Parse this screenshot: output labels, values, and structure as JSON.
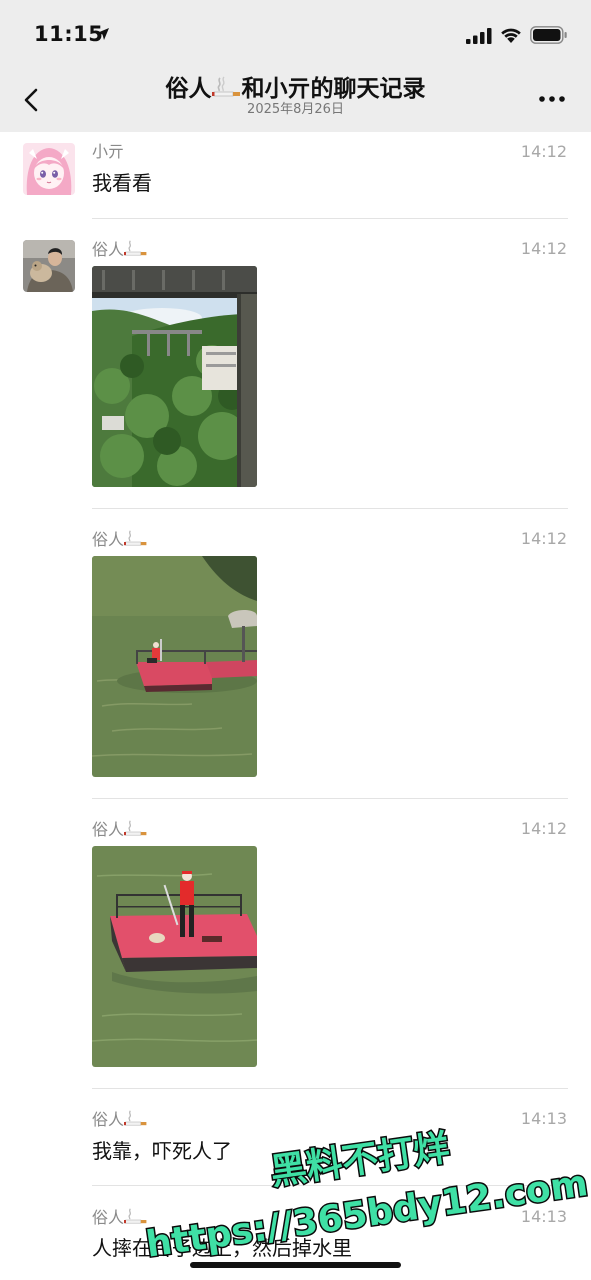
{
  "status": {
    "time": "11:15"
  },
  "header": {
    "title_left": "俗人",
    "title_right": "和小亓的聊天记录",
    "subtitle": "2025年8月26日",
    "back_icon": "chevron-left-icon",
    "more_icon": "more-icon"
  },
  "messages": [
    {
      "sender": "小亓",
      "time": "14:12",
      "type": "text",
      "text": "我看看"
    },
    {
      "sender": "俗人",
      "time": "14:12",
      "type": "image",
      "image": "bridge-and-hillside-photo"
    },
    {
      "sender": "俗人",
      "time": "14:12",
      "type": "image",
      "image": "red-raft-on-river-photo"
    },
    {
      "sender": "俗人",
      "time": "14:12",
      "type": "image",
      "image": "man-on-red-raft-photo"
    },
    {
      "sender": "俗人",
      "time": "14:13",
      "type": "text",
      "text": "我靠，吓死人了"
    },
    {
      "sender": "俗人",
      "time": "14:13",
      "type": "text",
      "text": "人摔在台子边上，然后掉水里"
    }
  ],
  "watermark": {
    "line1": "黑料不打烊",
    "line2": "https://365bdy12.com"
  },
  "colors": {
    "bar_bg": "#ededed",
    "divider": "#e3e3e3",
    "watermark_fill": "#3fe0a5"
  }
}
